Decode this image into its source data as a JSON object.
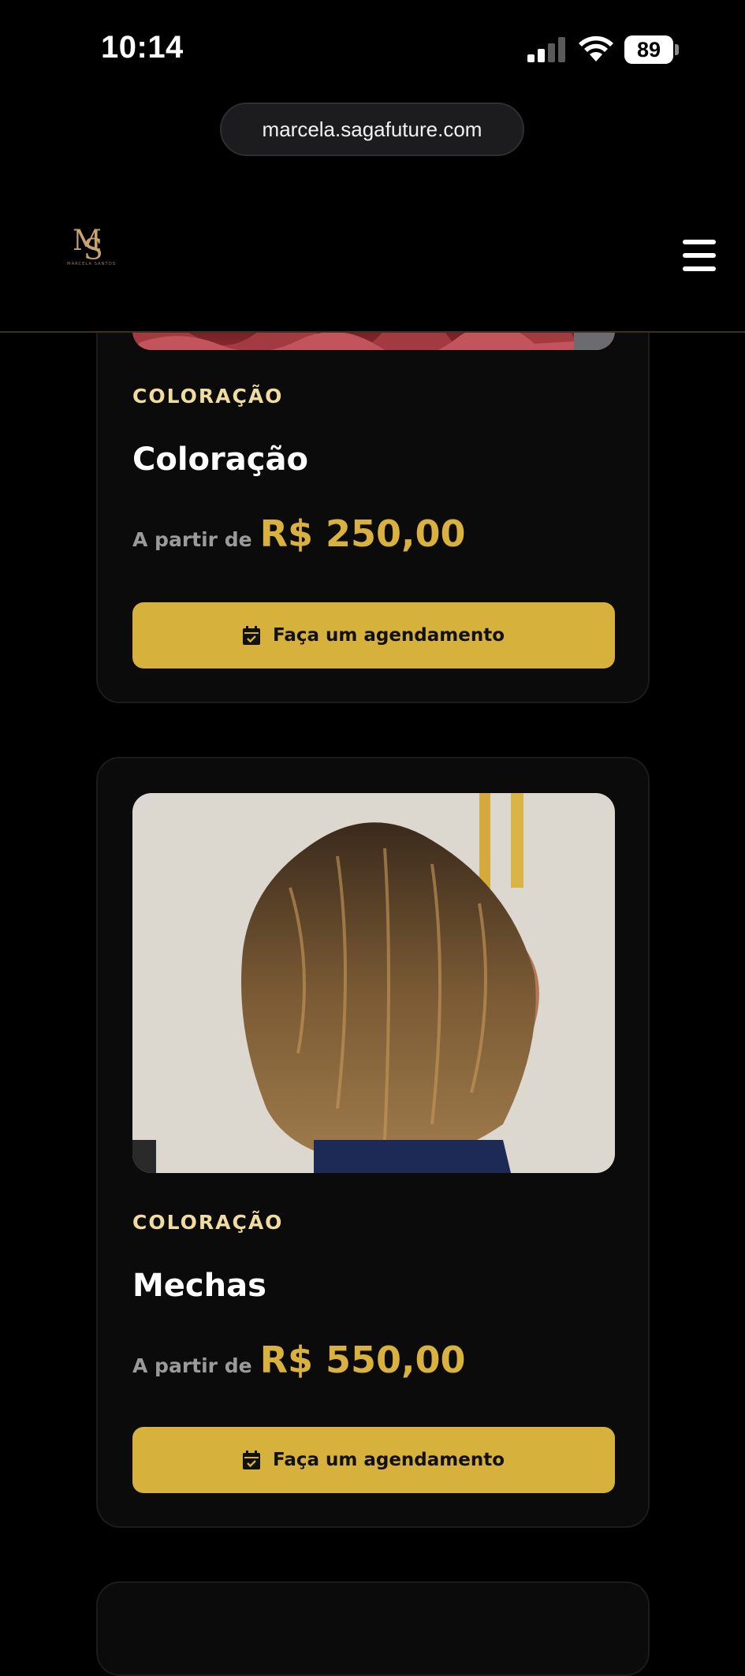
{
  "status_bar": {
    "time": "10:14",
    "battery": "89",
    "icons": [
      "signal-icon",
      "wifi-icon",
      "battery-icon"
    ]
  },
  "browser": {
    "url": "marcela.sagafuture.com"
  },
  "header": {
    "logo_text": "MARCELA SANTOS",
    "logo_initials": "MS",
    "menu_icon": "hamburger-menu-icon"
  },
  "colors": {
    "accent": "#d6b13b",
    "category": "#f1dca0",
    "price": "#d8b13e",
    "background": "#000000",
    "card": "#0b0b0b"
  },
  "services": [
    {
      "category": "COLORAÇÃO",
      "title": "Coloração",
      "price_prefix": "A partir de",
      "price": "R$ 250,00",
      "button_label": "Faça um agendamento",
      "button_icon": "calendar-check-icon"
    },
    {
      "category": "COLORAÇÃO",
      "title": "Mechas",
      "price_prefix": "A partir de",
      "price": "R$ 550,00",
      "button_label": "Faça um agendamento",
      "button_icon": "calendar-check-icon"
    }
  ]
}
